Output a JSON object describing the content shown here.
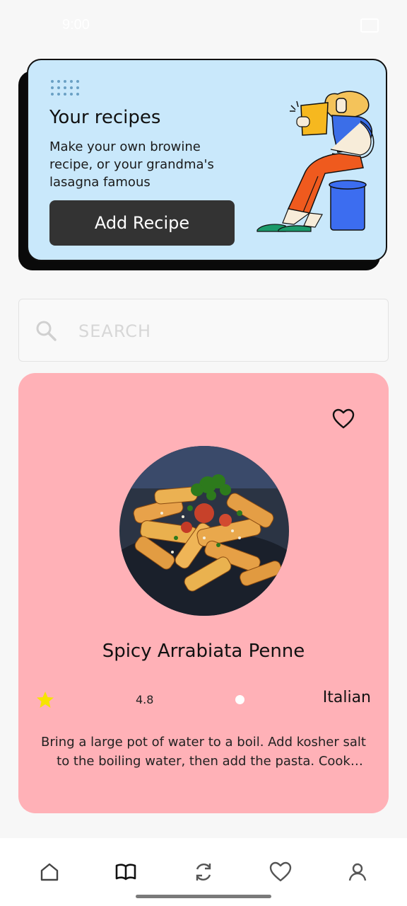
{
  "status_bar": {
    "time": "9:00"
  },
  "banner": {
    "title": "Your recipes",
    "text": "Make your own browine recipe, or your grandma's lasagna famous",
    "button_label": "Add Recipe"
  },
  "search": {
    "placeholder": "SEARCH",
    "value": ""
  },
  "recipe": {
    "title": "Spicy Arrabiata Penne",
    "rating": "4.8",
    "cuisine": "Italian",
    "description": "Bring a large pot of water to a boil. Add kosher salt to the boiling water, then add the pasta. Cook according to the package instructions."
  },
  "nav": {
    "items": [
      "home-icon",
      "book-icon",
      "refresh-icon",
      "heart-icon",
      "profile-icon"
    ],
    "active": "book-icon"
  },
  "colors": {
    "banner_bg": "#c9e8fb",
    "card_bg": "#ffb1b7",
    "button_bg": "#333333",
    "star": "#f6e400"
  }
}
